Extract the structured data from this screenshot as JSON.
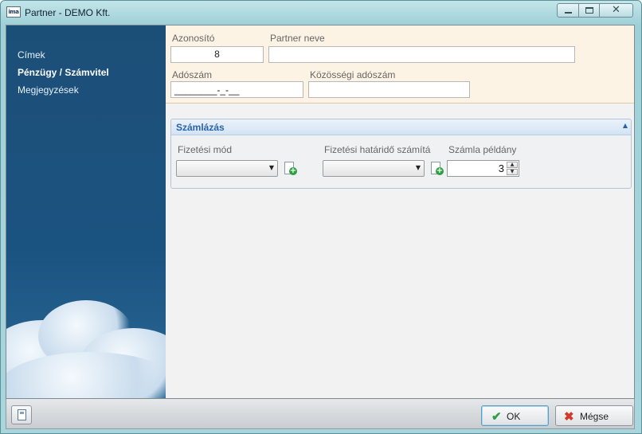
{
  "window": {
    "title": "Partner  - DEMO Kft.",
    "app_icon_text": "ima"
  },
  "sidebar": {
    "items": [
      {
        "label": "Címek"
      },
      {
        "label": "Pénzügy / Számvitel"
      },
      {
        "label": "Megjegyzések"
      }
    ]
  },
  "form": {
    "id_label": "Azonosító",
    "id_value": "8",
    "name_label": "Partner neve",
    "name_value": "",
    "tax_label": "Adószám",
    "tax_mask": "________-_-__",
    "eu_tax_label": "Közösségi adószám",
    "eu_tax_value": ""
  },
  "billing": {
    "title": "Számlázás",
    "payment_method_label": "Fizetési mód",
    "payment_method_value": "",
    "due_calc_label": "Fizetési határidő számítá",
    "due_calc_value": "",
    "copies_label": "Számla példány",
    "copies_value": "3"
  },
  "footer": {
    "ok_label": "OK",
    "cancel_label": "Mégse"
  },
  "colors": {
    "sidebar": "#1c4f78",
    "form_bg": "#fdf3e4",
    "group_title": "#2a64a8",
    "ok_check": "#2ea043",
    "cancel_x": "#d23a2a"
  }
}
